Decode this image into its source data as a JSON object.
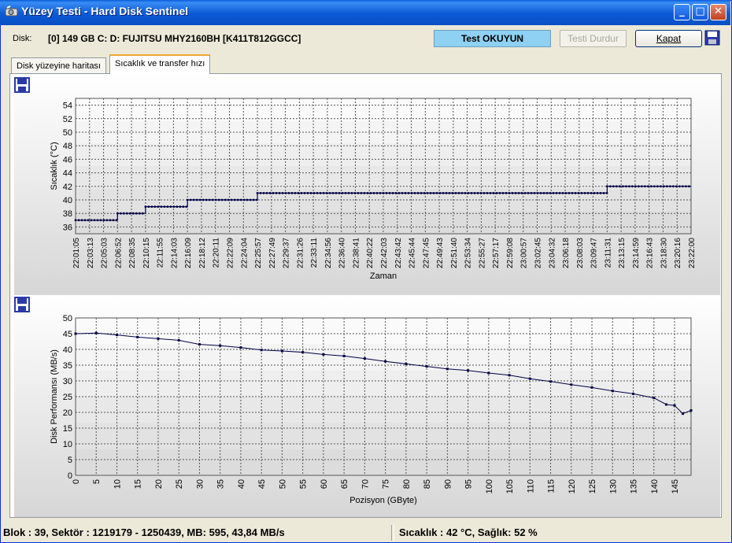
{
  "window": {
    "title": "Yüzey Testi  - Hard Disk Sentinel",
    "minimize": "_",
    "maximize": "□",
    "close": "✕"
  },
  "toolbar": {
    "disk_label": "Disk:",
    "disk_value": "[0] 149 GB C: D: FUJITSU MHY2160BH [K411T812GGCC]",
    "read_button": "Test OKUYUN",
    "stop_button": "Testi  Durdur",
    "close_button": "Kapat"
  },
  "tabs": [
    {
      "label": "Disk yüzeyine haritası"
    },
    {
      "label": "Sıcaklık ve transfer hızı"
    }
  ],
  "icons": {
    "save": "floppy-disk-icon",
    "app": "hard-disk-icon"
  },
  "colors": {
    "read_button": "#8ed1f2",
    "title_bar": "#0b5ad6",
    "series": "#000044"
  },
  "status": {
    "left": "Blok : 39, Sektör : 1219179 - 1250439, MB: 595, 43,84 MB/s",
    "right": "Sıcaklık : 42  °C,  Sağlık:  52 %"
  },
  "chart_data": [
    {
      "type": "line",
      "xlabel": "Zaman",
      "ylabel": "Sıcaklık  (°C)",
      "ylim": [
        35,
        55
      ],
      "yticks": [
        36,
        38,
        40,
        42,
        44,
        46,
        48,
        50,
        52,
        54
      ],
      "grid": true,
      "x_tick_labels": [
        "22:01:05",
        "22:03:13",
        "22:05:03",
        "22:06:52",
        "22:08:35",
        "22:10:15",
        "22:11:55",
        "22:14:03",
        "22:16:09",
        "22:18:12",
        "22:20:11",
        "22:22:09",
        "22:24:04",
        "22:25:57",
        "22:27:49",
        "22:29:37",
        "22:31:26",
        "22:33:11",
        "22:34:56",
        "22:36:40",
        "22:38:41",
        "22:40:22",
        "22:42:03",
        "22:43:42",
        "22:45:44",
        "22:47:45",
        "22:49:43",
        "22:51:40",
        "22:53:34",
        "22:55:27",
        "22:57:17",
        "22:59:08",
        "23:00:57",
        "23:02:45",
        "23:04:32",
        "23:06:18",
        "23:08:03",
        "23:09:47",
        "23:11:31",
        "23:13:15",
        "23:14:59",
        "23:16:43",
        "23:18:30",
        "23:20:16",
        "23:22:00"
      ],
      "steps": [
        {
          "from": "22:01:05",
          "value": 37
        },
        {
          "from": "22:06:52",
          "value": 38
        },
        {
          "from": "22:10:15",
          "value": 39
        },
        {
          "from": "22:16:09",
          "value": 40
        },
        {
          "from": "22:25:57",
          "value": 41
        },
        {
          "from": "23:11:31",
          "value": 42
        }
      ],
      "end": "23:22:00"
    },
    {
      "type": "scatter",
      "xlabel": "Pozisyon  (GByte)",
      "ylabel": "Disk Performansı  (MB/s)",
      "xlim": [
        0,
        149
      ],
      "ylim": [
        0,
        50
      ],
      "xticks": [
        0,
        5,
        10,
        15,
        20,
        25,
        30,
        35,
        40,
        45,
        50,
        55,
        60,
        65,
        70,
        75,
        80,
        85,
        90,
        95,
        100,
        105,
        110,
        115,
        120,
        125,
        130,
        135,
        140,
        145
      ],
      "yticks": [
        0,
        5,
        10,
        15,
        20,
        25,
        30,
        35,
        40,
        45,
        50
      ],
      "grid": true,
      "x": [
        0,
        5,
        10,
        15,
        20,
        25,
        30,
        35,
        40,
        45,
        50,
        55,
        60,
        65,
        70,
        75,
        80,
        85,
        90,
        95,
        100,
        105,
        110,
        115,
        120,
        125,
        130,
        135,
        140,
        143,
        145,
        147,
        149
      ],
      "y": [
        45,
        45.2,
        44.6,
        43.9,
        43.4,
        42.9,
        41.6,
        41.2,
        40.6,
        39.8,
        39.5,
        39.1,
        38.4,
        37.9,
        37.1,
        36.2,
        35.4,
        34.6,
        33.8,
        33.3,
        32.5,
        31.8,
        30.7,
        29.8,
        28.8,
        27.9,
        26.8,
        25.9,
        24.6,
        22.5,
        22.2,
        19.6,
        20.6
      ]
    }
  ]
}
